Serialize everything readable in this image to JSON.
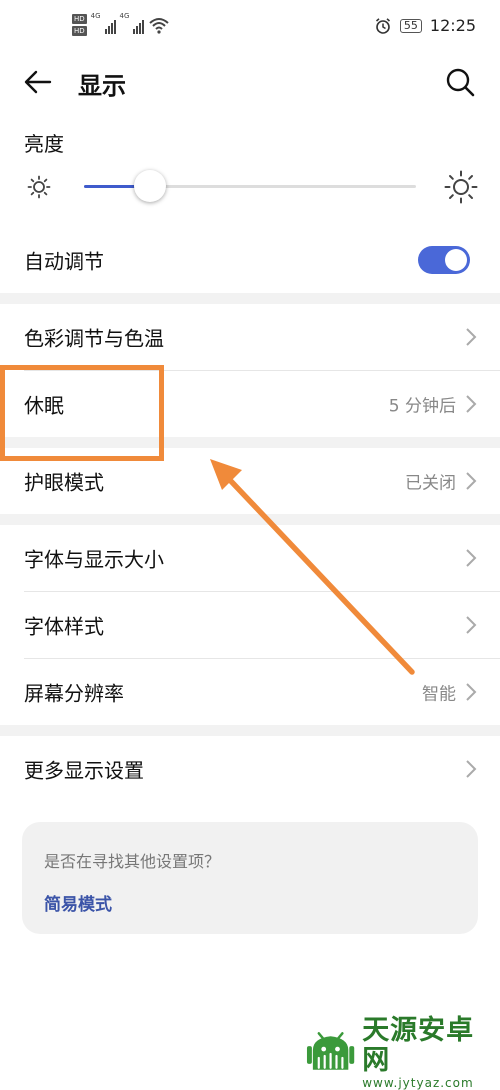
{
  "status_bar": {
    "time": "12:25",
    "battery": "55",
    "network_left": "4G",
    "network_right": "4G",
    "hd1": "HD",
    "hd2": "HD"
  },
  "header": {
    "title": "显示"
  },
  "brightness": {
    "label": "亮度",
    "level_fraction": 0.2
  },
  "settings": {
    "auto_adjust": {
      "label": "自动调节",
      "enabled": true
    },
    "color_temp": {
      "label": "色彩调节与色温"
    },
    "sleep": {
      "label": "休眠",
      "value": "5 分钟后"
    },
    "eye_comfort": {
      "label": "护眼模式",
      "value": "已关闭"
    },
    "font_size": {
      "label": "字体与显示大小"
    },
    "font_style": {
      "label": "字体样式"
    },
    "resolution": {
      "label": "屏幕分辨率",
      "value": "智能"
    },
    "more": {
      "label": "更多显示设置"
    }
  },
  "suggestion_card": {
    "question": "是否在寻找其他设置项？",
    "link": "简易模式"
  },
  "watermark": {
    "title": "天源安卓网",
    "url": "www.jytyaz.com"
  },
  "colors": {
    "accent": "#4a68d8",
    "annotation": "#f08a3a",
    "link": "#3b54a8"
  }
}
